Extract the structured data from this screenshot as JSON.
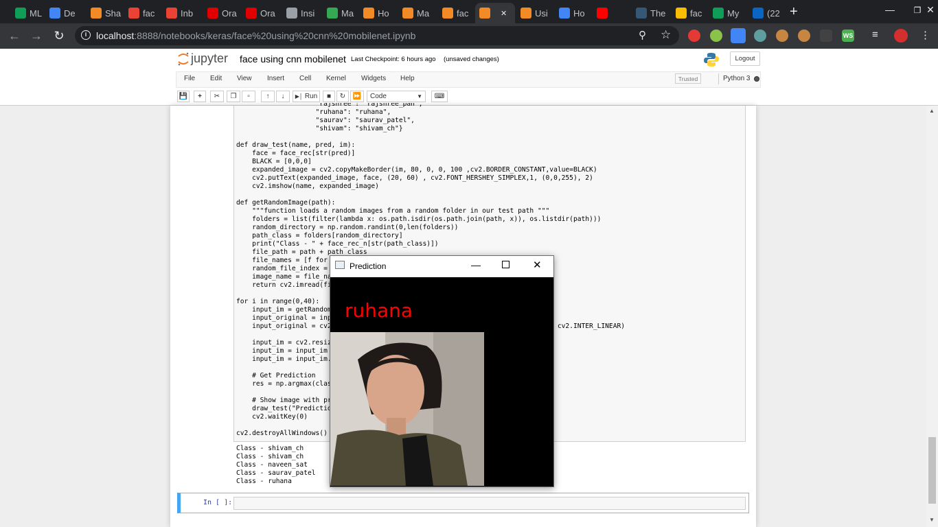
{
  "browser": {
    "tabs": [
      {
        "label": "ML",
        "icon": "drive-icon",
        "color": "#0f9d58"
      },
      {
        "label": "De",
        "icon": "drive-icon",
        "color": "#4285f4"
      },
      {
        "label": "Sha",
        "icon": "orange-ring-icon",
        "color": "#f28b26"
      },
      {
        "label": "fac",
        "icon": "gmail-icon",
        "color": "#ea4335"
      },
      {
        "label": "Inb",
        "icon": "gmail-icon",
        "color": "#ea4335"
      },
      {
        "label": "Ora",
        "icon": "oracle-icon",
        "color": "#e00000"
      },
      {
        "label": "Ora",
        "icon": "oracle-icon",
        "color": "#e00000"
      },
      {
        "label": "Insi",
        "icon": "triangle-icon",
        "color": "#9aa0a6"
      },
      {
        "label": "Ma",
        "icon": "green-ring-icon",
        "color": "#34a853"
      },
      {
        "label": "Ho",
        "icon": "orange-arc-icon",
        "color": "#f28b26"
      },
      {
        "label": "Ma",
        "icon": "notebook-icon",
        "color": "#f28b26"
      },
      {
        "label": "fac",
        "icon": "hourglass-icon",
        "color": "#f28b26"
      },
      {
        "label": "",
        "icon": "hourglass-icon",
        "color": "#f28b26",
        "active": true
      },
      {
        "label": "Usi",
        "icon": "notebook-icon",
        "color": "#f28b26"
      },
      {
        "label": "Ho",
        "icon": "globe-icon",
        "color": "#4285f4"
      },
      {
        "label": "",
        "icon": "youtube-icon",
        "color": "#ff0000"
      },
      {
        "label": "The",
        "icon": "tds-icon",
        "color": "#355876"
      },
      {
        "label": "fac",
        "icon": "smiley-icon",
        "color": "#fbbc04"
      },
      {
        "label": "My",
        "icon": "drive-icon",
        "color": "#0f9d58"
      },
      {
        "label": "(22",
        "icon": "linkedin-icon",
        "color": "#0a66c2"
      }
    ],
    "url_host": "localhost",
    "url_path": ":8888/notebooks/keras/face%20using%20cnn%20mobilenet.ipynb"
  },
  "jupyter": {
    "logo_text": "jupyter",
    "notebook_title": "face using cnn mobilenet",
    "checkpoint": "Last Checkpoint: 6 hours ago",
    "unsaved": "(unsaved changes)",
    "logout": "Logout",
    "menus": [
      "File",
      "Edit",
      "View",
      "Insert",
      "Cell",
      "Kernel",
      "Widgets",
      "Help"
    ],
    "trusted": "Trusted",
    "kernel": "Python 3",
    "run_label": "Run",
    "cell_type": "Code",
    "prompt": "In [ ]:"
  },
  "code_lines": [
    "                    \"rajshree\": \"rajshree_pan\",",
    "                    \"ruhana\": \"ruhana\",",
    "                    \"saurav\": \"saurav_patel\",",
    "                    \"shivam\": \"shivam_ch\"}",
    "",
    "def draw_test(name, pred, im):",
    "    face = face_rec[str(pred)]",
    "    BLACK = [0,0,0]",
    "    expanded_image = cv2.copyMakeBorder(im, 80, 0, 0, 100 ,cv2.BORDER_CONSTANT,value=BLACK)",
    "    cv2.putText(expanded_image, face, (20, 60) , cv2.FONT_HERSHEY_SIMPLEX,1, (0,0,255), 2)",
    "    cv2.imshow(name, expanded_image)",
    "",
    "def getRandomImage(path):",
    "    \"\"\"function loads a random images from a random folder in our test path \"\"\"",
    "    folders = list(filter(lambda x: os.path.isdir(os.path.join(path, x)), os.listdir(path)))",
    "    random_directory = np.random.randint(0,len(folders))",
    "    path_class = folders[random_directory]",
    "    print(\"Class - \" + face_rec_n[str(path_class)])",
    "    file_path = path + path_class",
    "    file_names = [f for",
    "    random_file_index =",
    "    image_name = file_na",
    "    return cv2.imread(fi",
    "",
    "for i in range(0,40):",
    "    input_im = getRandom",
    "    input_original = inp",
    "    input_original = cv2                                         interpolation = cv2.INTER_LINEAR)",
    "",
    "    input_im = cv2.resiz                                         )",
    "    input_im = input_im",
    "    input_im = input_im.",
    "",
    "    # Get Prediction",
    "    res = np.argmax(clas",
    "",
    "    # Show image with pr",
    "    draw_test(\"Predictio",
    "    cv2.waitKey(0)",
    "",
    "cv2.destroyAllWindows()"
  ],
  "output_lines": [
    "Class - shivam_ch",
    "Class - shivam_ch",
    "Class - naveen_sat",
    "Class - saurav_patel",
    "Class - ruhana"
  ],
  "prediction_window": {
    "title": "Prediction",
    "predicted_name": "ruhana",
    "text_color": "#ff0000"
  },
  "colors": {
    "accent": "#42a5f5",
    "prompt": "#303f9f"
  }
}
